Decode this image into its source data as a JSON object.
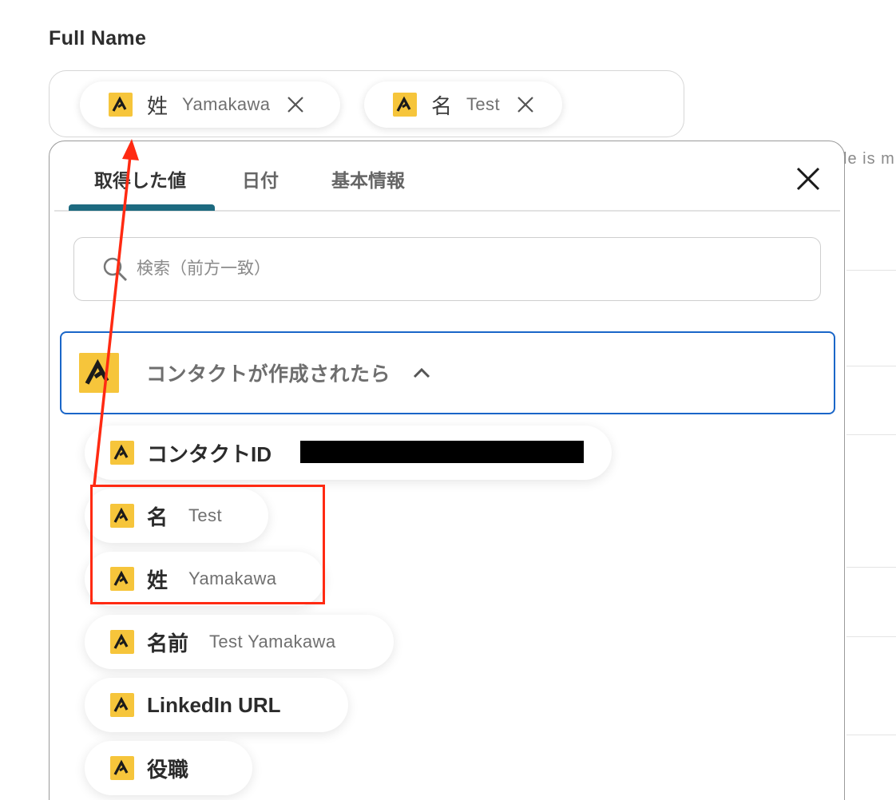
{
  "field": {
    "label": "Full Name",
    "chips": [
      {
        "icon": "app-logo-icon",
        "name": "姓",
        "value": "Yamakawa"
      },
      {
        "icon": "app-logo-icon",
        "name": "名",
        "value": "Test"
      }
    ]
  },
  "background": {
    "truncated_text": "le is m"
  },
  "popup": {
    "tabs": [
      {
        "label": "取得した値",
        "active": true
      },
      {
        "label": "日付",
        "active": false
      },
      {
        "label": "基本情報",
        "active": false
      }
    ],
    "search": {
      "placeholder": "検索（前方一致）",
      "value": ""
    },
    "group": {
      "title": "コンタクトが作成されたら",
      "expanded": true
    },
    "items": [
      {
        "label": "コンタクトID",
        "value": ""
      },
      {
        "label": "名",
        "value": "Test"
      },
      {
        "label": "姓",
        "value": "Yamakawa"
      },
      {
        "label": "名前",
        "value": "Test Yamakawa"
      },
      {
        "label": "LinkedIn URL",
        "value": ""
      },
      {
        "label": "役職",
        "value": ""
      }
    ]
  },
  "colors": {
    "accent_tab": "#1d6a80",
    "group_border": "#1a66c8",
    "annotation_red": "#ff2a12",
    "logo_yellow": "#f6c53b"
  }
}
